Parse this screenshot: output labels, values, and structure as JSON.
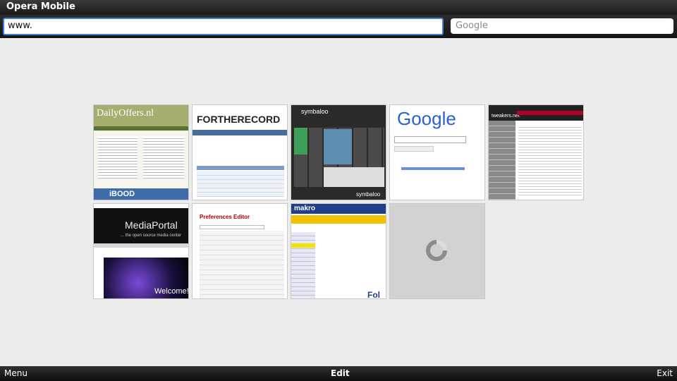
{
  "app": {
    "title": "Opera Mobile"
  },
  "address_bar": {
    "url_value": "www.",
    "search_placeholder": "Google"
  },
  "speed_dial": {
    "tiles": [
      {
        "logo_text": "DailyOffers.nl",
        "footer": "iBOOD"
      },
      {
        "logo_text": "FORTHERECORD"
      },
      {
        "logo_text": "symbaloo",
        "footer": "symbaloo"
      },
      {
        "logo_text": "Google"
      },
      {
        "logo_text": "tweakers.net"
      },
      {
        "logo_text": "MediaPortal",
        "tagline": "... the open source media center",
        "banner": "Welcome!"
      },
      {
        "logo_text": "Preferences Editor"
      },
      {
        "logo_text": "makro",
        "footer": "Fol"
      },
      {
        "state": "loading"
      }
    ]
  },
  "bottom_bar": {
    "menu": "Menu",
    "edit": "Edit",
    "exit": "Exit"
  },
  "colors": {
    "accent": "#3c7fd8",
    "bar": "#1a1a1a"
  }
}
